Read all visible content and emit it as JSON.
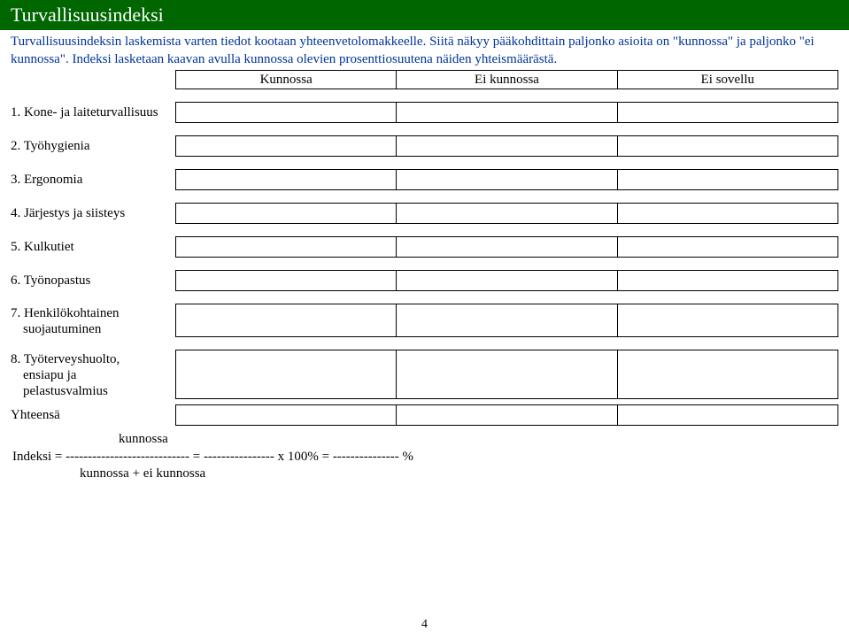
{
  "header": {
    "title": "Turvallisuusindeksi"
  },
  "intro": {
    "text": "Turvallisuusindeksin laskemista varten tiedot kootaan yhteenvetolomakkeelle. Siitä näkyy pääkohdittain paljonko asioita on \"kunnossa\" ja paljonko \"ei kunnossa\". Indeksi lasketaan kaavan avulla kunnossa olevien prosenttiosuutena näiden yhteismäärästä."
  },
  "columns": {
    "c1": "Kunnossa",
    "c2": "Ei kunnossa",
    "c3": "Ei sovellu"
  },
  "rows": [
    {
      "label": "1. Kone- ja laiteturvallisuus"
    },
    {
      "label": "2. Työhygienia"
    },
    {
      "label": "3. Ergonomia"
    },
    {
      "label": "4. Järjestys ja siisteys"
    },
    {
      "label": "5. Kulkutiet"
    },
    {
      "label": "6. Työnopastus"
    },
    {
      "label": "7. Henkilökohtainen",
      "label2": "suojautuminen"
    },
    {
      "label": "8. Työterveyshuolto,",
      "label2": "ensiapu ja",
      "label3": "pelastusvalmius"
    },
    {
      "label": "Yhteensä"
    }
  ],
  "formula": {
    "top": "kunnossa",
    "mid": "Indeksi = ----------------------------   =  ----------------  x  100%    =  ---------------  %",
    "bot": "kunnossa + ei kunnossa"
  },
  "pageNumber": "4"
}
